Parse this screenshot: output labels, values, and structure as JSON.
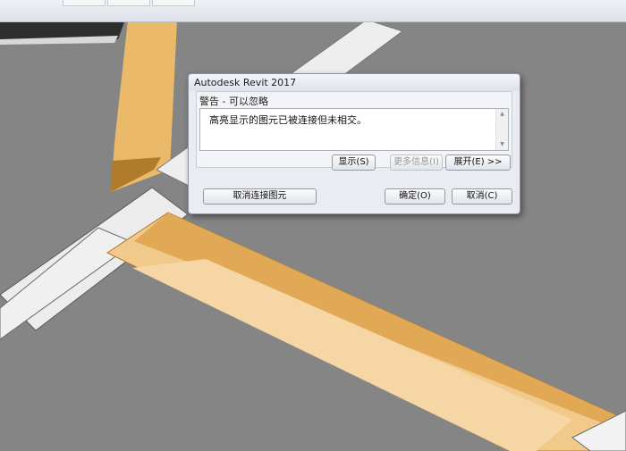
{
  "dialog": {
    "title": "Autodesk Revit 2017",
    "heading": "警告 - 可以忽略",
    "message": "高亮显示的图元已被连接但未相交。",
    "buttons": {
      "show": "显示(S)",
      "more_info": "更多信息(I)",
      "expand": "展开(E) >>",
      "unjoin": "取消连接图元",
      "ok": "确定(O)",
      "cancel": "取消(C)"
    }
  },
  "colors": {
    "viewport_background": "#858585",
    "highlighted_element": "#f1c98a",
    "beam": "#eeeeee"
  },
  "icons": {
    "scroll_up": "scroll-up-arrow-icon",
    "scroll_down": "scroll-down-arrow-icon"
  }
}
